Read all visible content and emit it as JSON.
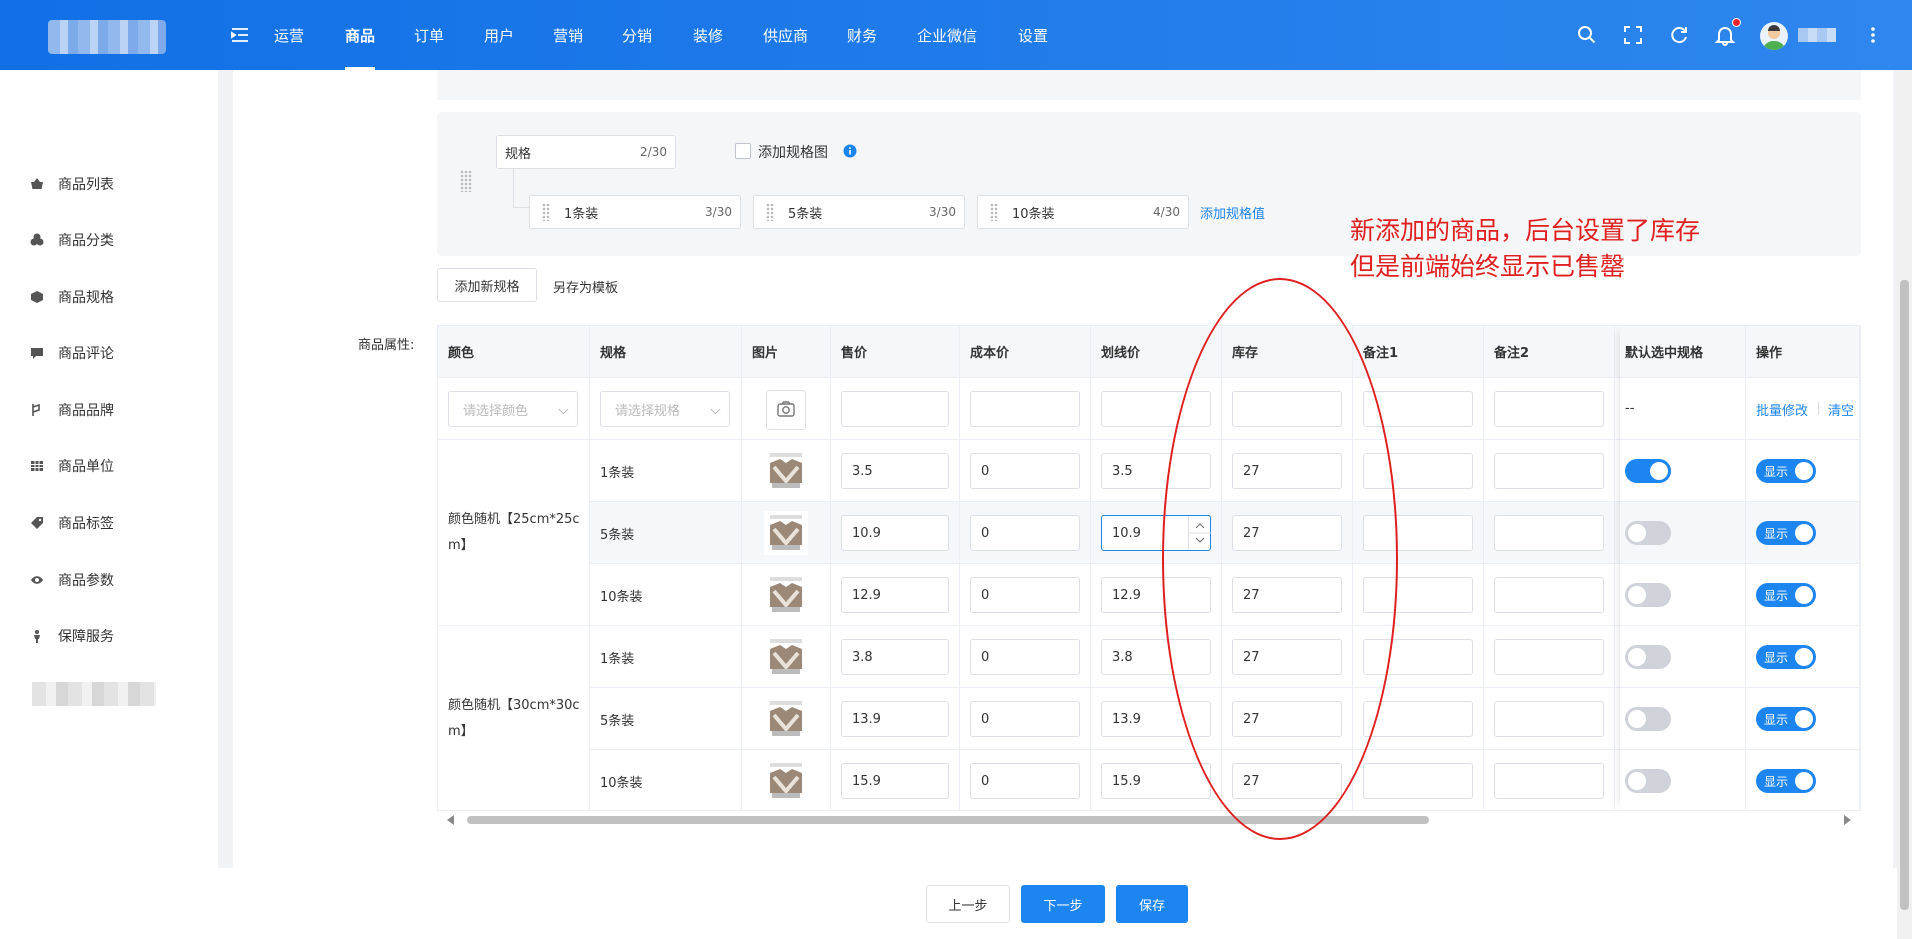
{
  "nav": {
    "items": [
      "运营",
      "商品",
      "订单",
      "用户",
      "营销",
      "分销",
      "装修",
      "供应商",
      "财务",
      "企业微信",
      "设置"
    ],
    "active_index": 1,
    "bell_badge_color": "#f5222d"
  },
  "sidebar": {
    "items": [
      {
        "label": "商品列表",
        "icon": "basket-icon"
      },
      {
        "label": "商品分类",
        "icon": "category-icon"
      },
      {
        "label": "商品规格",
        "icon": "cube-icon"
      },
      {
        "label": "商品评论",
        "icon": "comment-icon"
      },
      {
        "label": "商品品牌",
        "icon": "brand-icon"
      },
      {
        "label": "商品单位",
        "icon": "grid-icon"
      },
      {
        "label": "商品标签",
        "icon": "tag-icon"
      },
      {
        "label": "商品参数",
        "icon": "eye-icon"
      },
      {
        "label": "保障服务",
        "icon": "person-icon"
      }
    ]
  },
  "spec": {
    "name_value": "规格",
    "name_count": "2/30",
    "add_image_label": "添加规格图",
    "values": [
      {
        "value": "1条装",
        "count": "3/30"
      },
      {
        "value": "5条装",
        "count": "3/30"
      },
      {
        "value": "10条装",
        "count": "4/30"
      }
    ],
    "add_value_link": "添加规格值",
    "add_new_spec_button": "添加新规格",
    "save_template_link": "另存为模板"
  },
  "annotation": {
    "line1": "新添加的商品，后台设置了库存",
    "line2": "但是前端始终显示已售罄",
    "color": "#e02020"
  },
  "table": {
    "label": "商品属性:",
    "headers": [
      "颜色",
      "规格",
      "图片",
      "售价",
      "成本价",
      "划线价",
      "库存",
      "备注1",
      "备注2",
      "默认选中规格",
      "操作"
    ],
    "batch": {
      "color_placeholder": "请选择颜色",
      "spec_placeholder": "请选择规格",
      "default_text": "--",
      "batch_edit": "批量修改",
      "clear": "清空"
    },
    "groups": [
      {
        "color": "颜色随机【25cm*25cm】",
        "color_lines": [
          "颜色随机【25cm*25c",
          "m】"
        ]
      },
      {
        "color": "颜色随机【30cm*30cm】",
        "color_lines": [
          "颜色随机【30cm*30c",
          "m】"
        ]
      }
    ],
    "rows": [
      {
        "spec": "1条装",
        "price": "3.5",
        "cost": "0",
        "line_price": "3.5",
        "stock": "27",
        "default_on": true,
        "display": "显示"
      },
      {
        "spec": "5条装",
        "price": "10.9",
        "cost": "0",
        "line_price": "10.9",
        "stock": "27",
        "default_on": false,
        "display": "显示"
      },
      {
        "spec": "10条装",
        "price": "12.9",
        "cost": "0",
        "line_price": "12.9",
        "stock": "27",
        "default_on": false,
        "display": "显示"
      },
      {
        "spec": "1条装",
        "price": "3.8",
        "cost": "0",
        "line_price": "3.8",
        "stock": "27",
        "default_on": false,
        "display": "显示"
      },
      {
        "spec": "5条装",
        "price": "13.9",
        "cost": "0",
        "line_price": "13.9",
        "stock": "27",
        "default_on": false,
        "display": "显示"
      },
      {
        "spec": "10条装",
        "price": "15.9",
        "cost": "0",
        "line_price": "15.9",
        "stock": "27",
        "default_on": false,
        "display": "显示"
      }
    ]
  },
  "footer": {
    "prev": "上一步",
    "next": "下一步",
    "save": "保存"
  },
  "colors": {
    "primary": "#1d85f0",
    "topbar": "#1677e8"
  }
}
